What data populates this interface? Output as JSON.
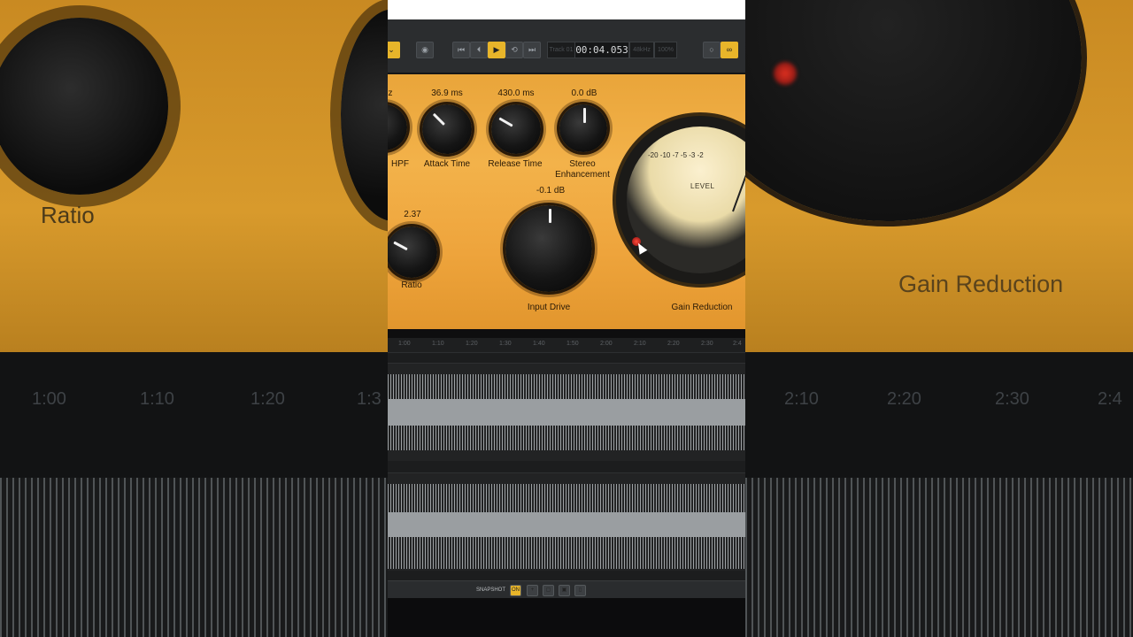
{
  "background": {
    "left_label": "Ratio",
    "right_label": "Gain Reduction",
    "ruler": [
      "1:00",
      "1:10",
      "1:20",
      "1:3",
      "2:10",
      "2:20",
      "2:30",
      "2:4"
    ]
  },
  "transport": {
    "power_icon": "power-icon",
    "buttons": [
      "rewind-to-start-icon",
      "previous-icon",
      "play-icon",
      "loop-icon",
      "forward-to-end-icon"
    ],
    "track_cell": "Track 01",
    "timecode": "00:04.053",
    "rate_cell": "48kHz",
    "zoom_cell": "100%",
    "right_icons": [
      "record-icon",
      "mono-stereo-icon"
    ]
  },
  "plugin": {
    "hpf": {
      "label": "HPF",
      "value": "z"
    },
    "attack": {
      "label": "Attack Time",
      "value": "36.9 ms"
    },
    "release": {
      "label": "Release Time",
      "value": "430.0 ms"
    },
    "stereo": {
      "label1": "Stereo",
      "label2": "Enhancement",
      "value": "0.0 dB"
    },
    "ratio": {
      "label": "Ratio",
      "value": "2.37"
    },
    "input_drive": {
      "label": "Input Drive",
      "value": "-0.1 dB"
    },
    "meter": {
      "scale": "-20  -10  -7   -5  -3  -2",
      "level": "LEVEL",
      "label": "Gain Reduction"
    }
  },
  "timeline": {
    "marks": [
      "1:00",
      "1:10",
      "1:20",
      "1:30",
      "1:40",
      "1:50",
      "2:00",
      "2:10",
      "2:20",
      "2:30",
      "2:4"
    ]
  },
  "snapshot": {
    "label": "SNAPSHOT",
    "on_label": "ON",
    "buttons": [
      "add-icon",
      "copy-icon",
      "paste-icon",
      "delete-icon"
    ]
  }
}
